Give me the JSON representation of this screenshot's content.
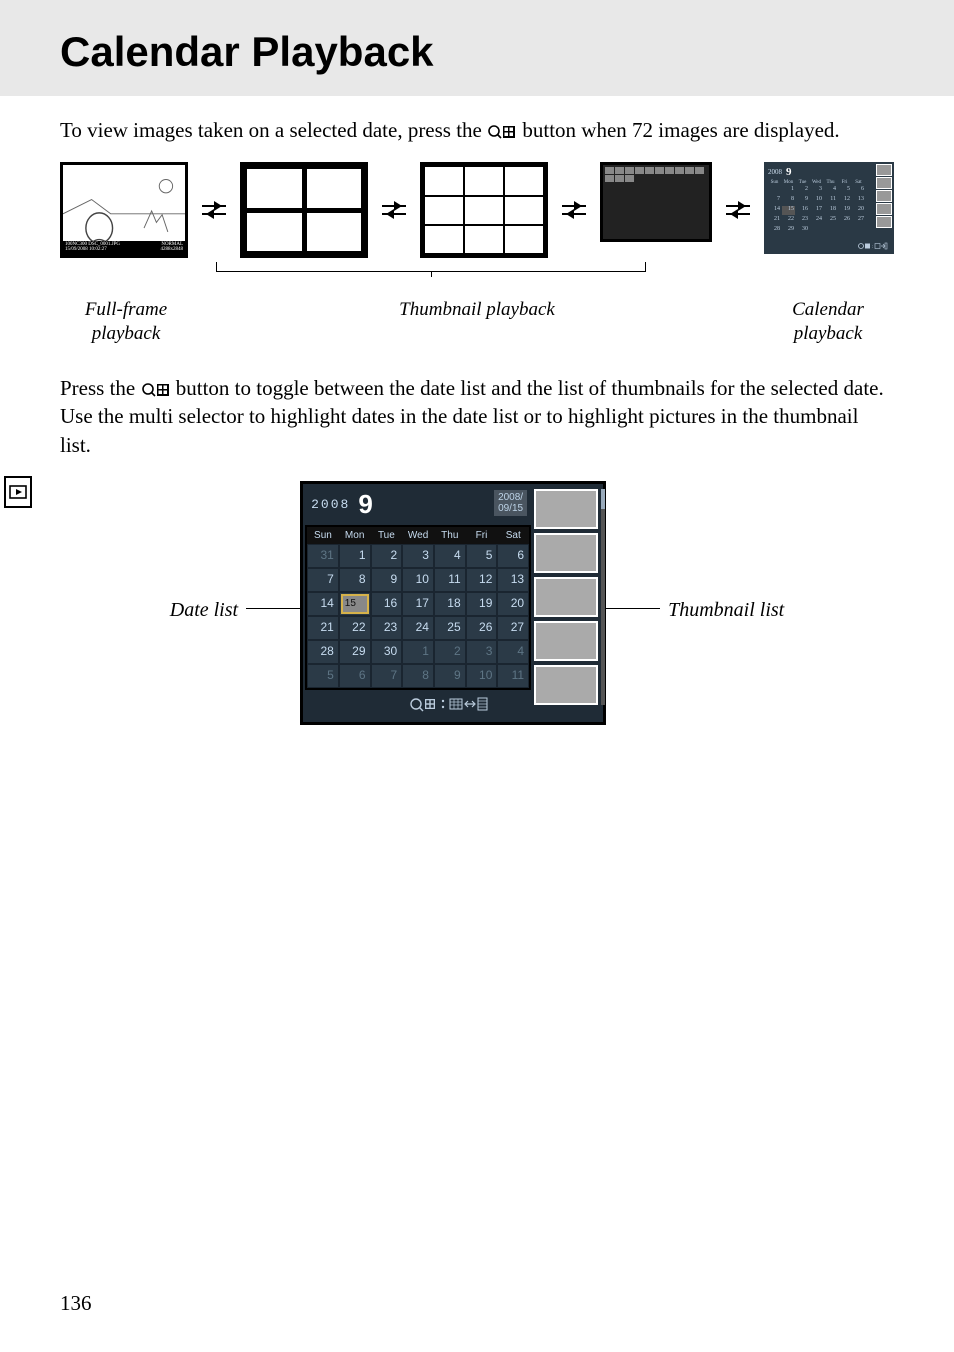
{
  "title": "Calendar Playback",
  "paragraph1_pre": "To view images taken on a selected date, press the ",
  "paragraph1_post": " button when 72 images are displayed.",
  "captions": {
    "full_frame": "Full-frame playback",
    "thumbnail": "Thumbnail playback",
    "calendar": "Calendar playback"
  },
  "paragraph2_pre": "Press the ",
  "paragraph2_post": " button to toggle between the date list and the list of thumbnails for the selected date.  Use the multi selector to highlight dates in the date list or to highlight pictures in the thumbnail list.",
  "labels": {
    "date_list": "Date list",
    "thumbnail_list": "Thumbnail list"
  },
  "page_number": "136",
  "full_frame_overlay": {
    "folder": "100NC300",
    "file": "DSC_0001.JPG",
    "date": "15/09/2008",
    "time": "10:02:27",
    "quality": "NORMAL",
    "size": "4288x2848"
  },
  "mini_calendar": {
    "year": "2008",
    "month": "9",
    "weekdays": [
      "Sun",
      "Mon",
      "Tue",
      "Wed",
      "Thu",
      "Fri",
      "Sat"
    ],
    "rows": [
      [
        "",
        "1",
        "2",
        "3",
        "4",
        "5",
        "6"
      ],
      [
        "7",
        "8",
        "9",
        "10",
        "11",
        "12",
        "13"
      ],
      [
        "14",
        "15",
        "16",
        "17",
        "18",
        "19",
        "20"
      ],
      [
        "21",
        "22",
        "23",
        "24",
        "25",
        "26",
        "27"
      ],
      [
        "28",
        "29",
        "30",
        "",
        "",
        "",
        ""
      ]
    ],
    "selected": "15"
  },
  "big_calendar": {
    "year": "2008",
    "month": "9",
    "date_box_line1": "2008/",
    "date_box_line2": "09/15",
    "weekdays": [
      "Sun",
      "Mon",
      "Tue",
      "Wed",
      "Thu",
      "Fri",
      "Sat"
    ],
    "cells": [
      {
        "n": "31",
        "dim": true
      },
      {
        "n": "1"
      },
      {
        "n": "2"
      },
      {
        "n": "3"
      },
      {
        "n": "4"
      },
      {
        "n": "5"
      },
      {
        "n": "6"
      },
      {
        "n": "7"
      },
      {
        "n": "8"
      },
      {
        "n": "9"
      },
      {
        "n": "10"
      },
      {
        "n": "11"
      },
      {
        "n": "12"
      },
      {
        "n": "13"
      },
      {
        "n": "14"
      },
      {
        "n": "15",
        "sel": true
      },
      {
        "n": "16"
      },
      {
        "n": "17"
      },
      {
        "n": "18"
      },
      {
        "n": "19"
      },
      {
        "n": "20"
      },
      {
        "n": "21"
      },
      {
        "n": "22"
      },
      {
        "n": "23"
      },
      {
        "n": "24"
      },
      {
        "n": "25"
      },
      {
        "n": "26"
      },
      {
        "n": "27"
      },
      {
        "n": "28"
      },
      {
        "n": "29"
      },
      {
        "n": "30"
      },
      {
        "n": "1",
        "dim": true
      },
      {
        "n": "2",
        "dim": true
      },
      {
        "n": "3",
        "dim": true
      },
      {
        "n": "4",
        "dim": true
      },
      {
        "n": "5",
        "dim": true
      },
      {
        "n": "6",
        "dim": true
      },
      {
        "n": "7",
        "dim": true
      },
      {
        "n": "8",
        "dim": true
      },
      {
        "n": "9",
        "dim": true
      },
      {
        "n": "10",
        "dim": true
      },
      {
        "n": "11",
        "dim": true
      }
    ]
  },
  "icon_names": {
    "zoom_out_thumb": "zoom-out-thumbnail-icon",
    "playback": "playback-icon",
    "footer_glyph": "zoom-calendar-toggle-icon"
  }
}
